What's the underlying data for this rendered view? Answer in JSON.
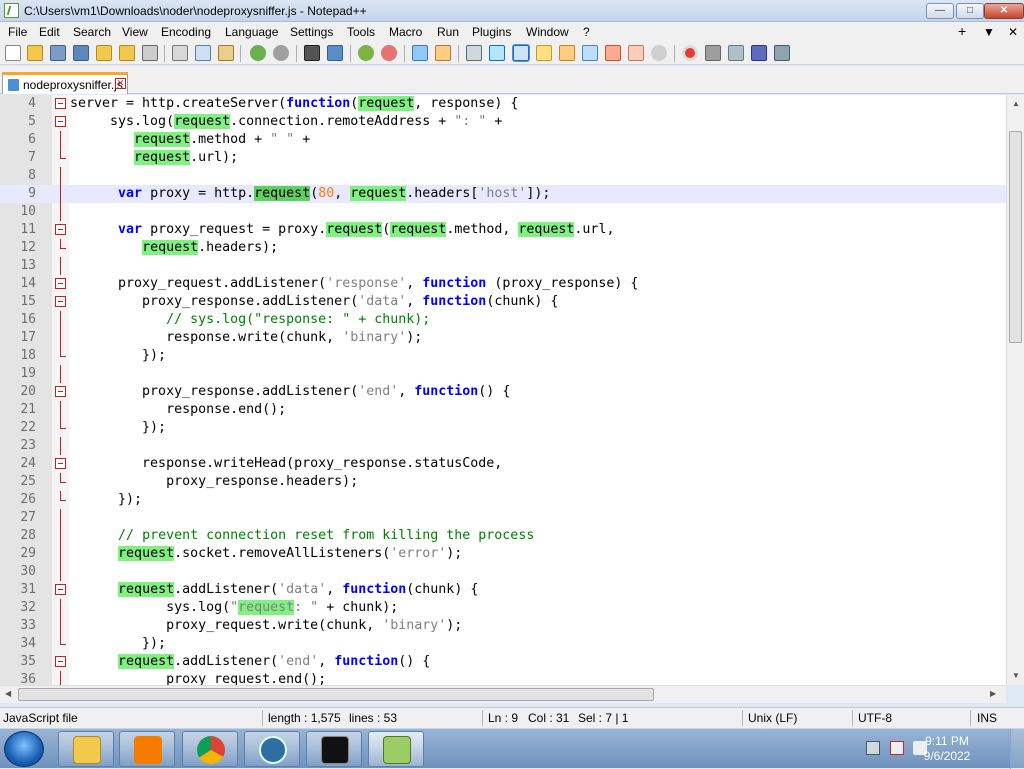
{
  "window": {
    "title": "C:\\Users\\vm1\\Downloads\\noder\\nodeproxysniffer.js - Notepad++",
    "min": "—",
    "max": "□",
    "close": "✕"
  },
  "menu": {
    "items": [
      "File",
      "Edit",
      "Search",
      "View",
      "Encoding",
      "Language",
      "Settings",
      "Tools",
      "Macro",
      "Run",
      "Plugins",
      "Window",
      "?"
    ],
    "right": [
      "+",
      "▼",
      "✕"
    ]
  },
  "tabs": [
    {
      "label": "nodeproxysniffer.js",
      "close": "✕"
    }
  ],
  "editor": {
    "lines": [
      {
        "n": "4",
        "fold": "box",
        "html": "server = http.createServer(<span class='kw'>function</span>(<span class='hl'>request</span>, response) {"
      },
      {
        "n": "5",
        "fold": "box",
        "html": "     sys.log(<span class='hl'>request</span>.connection.remoteAddress + <span class='st'>\": \"</span> +"
      },
      {
        "n": "6",
        "fold": "line",
        "html": "        <span class='hl'>request</span>.method + <span class='st'>\" \"</span> +"
      },
      {
        "n": "7",
        "fold": "end",
        "html": "        <span class='hl'>request</span>.url);"
      },
      {
        "n": "8",
        "fold": "line",
        "html": ""
      },
      {
        "n": "9",
        "fold": "line",
        "html": "      <span class='kw'>var</span> proxy = http.<span class='hl2'>request</span>(<span class='nm'>80</span>, <span class='hl'>request</span>.headers[<span class='st'>'host'</span>]);",
        "current": true
      },
      {
        "n": "10",
        "fold": "line",
        "html": ""
      },
      {
        "n": "11",
        "fold": "box",
        "html": "      <span class='kw'>var</span> proxy_request = proxy.<span class='hl'>request</span>(<span class='hl'>request</span>.method, <span class='hl'>request</span>.url,"
      },
      {
        "n": "12",
        "fold": "end",
        "html": "         <span class='hl'>request</span>.headers);"
      },
      {
        "n": "13",
        "fold": "line",
        "html": ""
      },
      {
        "n": "14",
        "fold": "box",
        "html": "      proxy_request.addListener(<span class='st'>'response'</span>, <span class='kw'>function</span> (proxy_response) {"
      },
      {
        "n": "15",
        "fold": "box",
        "html": "         proxy_response.addListener(<span class='st'>'data'</span>, <span class='kw'>function</span>(chunk) {"
      },
      {
        "n": "16",
        "fold": "line",
        "html": "            <span class='cm'>// sys.log(\"response: \" + chunk);</span>"
      },
      {
        "n": "17",
        "fold": "line",
        "html": "            response.write(chunk, <span class='st'>'binary'</span>);"
      },
      {
        "n": "18",
        "fold": "end",
        "html": "         });"
      },
      {
        "n": "19",
        "fold": "line",
        "html": ""
      },
      {
        "n": "20",
        "fold": "box",
        "html": "         proxy_response.addListener(<span class='st'>'end'</span>, <span class='kw'>function</span>() {"
      },
      {
        "n": "21",
        "fold": "line",
        "html": "            response.end();"
      },
      {
        "n": "22",
        "fold": "end",
        "html": "         });"
      },
      {
        "n": "23",
        "fold": "line",
        "html": ""
      },
      {
        "n": "24",
        "fold": "box",
        "html": "         response.writeHead(proxy_response.statusCode,"
      },
      {
        "n": "25",
        "fold": "end",
        "html": "            proxy_response.headers);"
      },
      {
        "n": "26",
        "fold": "end",
        "html": "      });"
      },
      {
        "n": "27",
        "fold": "line",
        "html": ""
      },
      {
        "n": "28",
        "fold": "line",
        "html": "      <span class='cm'>// prevent connection reset from killing the process</span>"
      },
      {
        "n": "29",
        "fold": "line",
        "html": "      <span class='hl'>request</span>.socket.removeAllListeners(<span class='st'>'error'</span>);"
      },
      {
        "n": "30",
        "fold": "line",
        "html": ""
      },
      {
        "n": "31",
        "fold": "box",
        "html": "      <span class='hl'>request</span>.addListener(<span class='st'>'data'</span>, <span class='kw'>function</span>(chunk) {"
      },
      {
        "n": "32",
        "fold": "line",
        "html": "            sys.log(<span class='st'>\"<span class='hl'>request</span>: \"</span> + chunk);"
      },
      {
        "n": "33",
        "fold": "line",
        "html": "            proxy_request.write(chunk, <span class='st'>'binary'</span>);"
      },
      {
        "n": "34",
        "fold": "end",
        "html": "         });"
      },
      {
        "n": "35",
        "fold": "box",
        "html": "      <span class='hl'>request</span>.addListener(<span class='st'>'end'</span>, <span class='kw'>function</span>() {"
      },
      {
        "n": "36",
        "fold": "line",
        "html": "            proxy_request.end();"
      }
    ]
  },
  "status": {
    "file_type": "JavaScript file",
    "length": "length : 1,575",
    "lines": "lines : 53",
    "ln": "Ln : 9",
    "col": "Col : 31",
    "sel": "Sel : 7 | 1",
    "eol": "Unix (LF)",
    "encoding": "UTF-8",
    "mode": "INS"
  },
  "taskbar": {
    "time": "9:11 PM",
    "date": "9/6/2022",
    "apps": [
      "explorer-icon",
      "media-player-icon",
      "chrome-icon",
      "kodi-icon",
      "cmd-icon",
      "notepadpp-icon"
    ]
  }
}
